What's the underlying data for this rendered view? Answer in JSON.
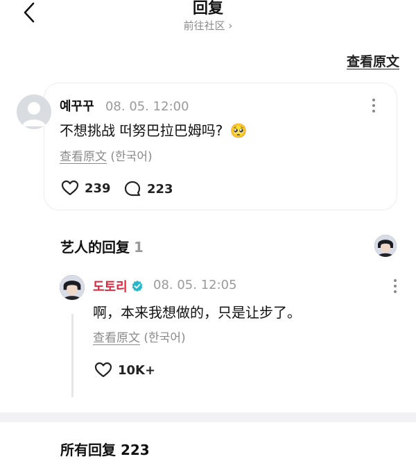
{
  "header": {
    "title": "回复",
    "subtitle": "前往社区 ›",
    "back_icon": "chevron-left-icon"
  },
  "view_original_top": "查看原文",
  "comment": {
    "author": "예꾸꾸",
    "time": "08. 05. 12:00",
    "text": "不想挑战 떠努巴拉巴姆吗?",
    "emoji": "🥺",
    "view_original": "查看原文",
    "language": "(한국어)",
    "likes": "239",
    "replies": "223"
  },
  "artist_section": {
    "title": "艺人的回复",
    "count": "1"
  },
  "artist_reply": {
    "author": "도토리",
    "author_color": "#e0243a",
    "verified_color": "#27b7c9",
    "time": "08. 05. 12:05",
    "text": "啊，本来我想做的，只是让步了。",
    "view_original": "查看原文",
    "language": "(한국어)",
    "likes": "10K+"
  },
  "bottom_section": {
    "title": "所有回复 223"
  }
}
